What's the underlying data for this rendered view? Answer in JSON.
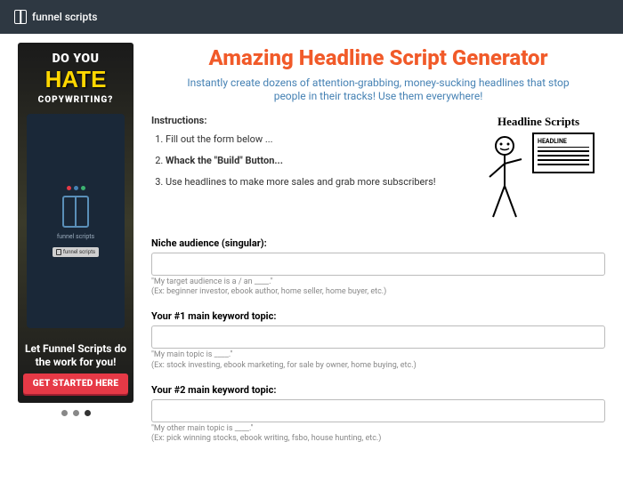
{
  "header": {
    "brand": "funnel scripts"
  },
  "sidebar": {
    "ad": {
      "line1": "DO YOU",
      "hate": "HATE",
      "line2": "COPYWRITING?",
      "boxLabel": "funnel scripts",
      "tagLabel": "funnel scripts",
      "sub": "Let Funnel Scripts do the work for you!",
      "cta": "GET STARTED HERE"
    }
  },
  "title": "Amazing Headline Script Generator",
  "subtitle": "Instantly create dozens of attention-grabbing, money-sucking headlines that stop people in their tracks! Use them everywhere!",
  "instructions": {
    "heading": "Instructions:",
    "step1": "Fill out the form below ...",
    "step2": "Whack the \"Build\" Button...",
    "step3": "Use headlines to make more sales and grab more subscribers!"
  },
  "illustration": {
    "title": "Headline Scripts",
    "boxTitle": "HEADLINE"
  },
  "form": {
    "f1": {
      "label": "Niche audience (singular):",
      "hint1": "\"My target audience is a / an ____.\"",
      "hint2": "(Ex: beginner investor, ebook author, home seller, home buyer, etc.)"
    },
    "f2": {
      "label": "Your #1 main keyword topic:",
      "hint1": "\"My main topic is ____.\"",
      "hint2": "(Ex: stock investing, ebook marketing, for sale by owner, home buying, etc.)"
    },
    "f3": {
      "label": "Your #2 main keyword topic:",
      "hint1": "\"My other main topic is ____.\"",
      "hint2": "(Ex: pick winning stocks, ebook writing, fsbo, house hunting, etc.)"
    }
  }
}
